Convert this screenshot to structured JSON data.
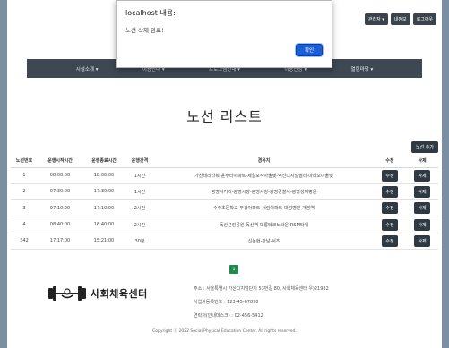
{
  "top_buttons": [
    "관리자 ▾",
    "내정보",
    "로그아웃"
  ],
  "nav": [
    "시설소개 ▾",
    "이용안내 ▾",
    "프로그램안내 ▾",
    "이용신청 ▾",
    "열린마당 ▾"
  ],
  "alert": {
    "title": "localhost 내용:",
    "message": "노선 삭제 완료!",
    "ok": "확인"
  },
  "heading": "노선 리스트",
  "add_button": "노선 추가",
  "table": {
    "headers": [
      "노선번호",
      "운행시작시간",
      "운행종료시간",
      "운행간격",
      "경유지",
      "수정",
      "삭제"
    ],
    "rows": [
      [
        "1",
        "08:00:00",
        "18:00:00",
        "1시간",
        "가산테라타워-윤부터아파트-제일포작아울렛-엑신디지털밸리-마리오아울렛"
      ],
      [
        "2",
        "07:30:00",
        "17:30:00",
        "1시간",
        "광명사거리-광명시장-광명시청-광명경찰서-광명성애병원"
      ],
      [
        "3",
        "07:10:00",
        "17:10:00",
        "2시간",
        "수주초등학교-부강아파트-서림아파트-대성병원-개봉역"
      ],
      [
        "4",
        "08:40:00",
        "16:40:00",
        "2시간",
        "독산근린공원-독산역-대륭테크노타운-RSM타워"
      ],
      [
        "342",
        "17:17:00",
        "15:21:00",
        "30분",
        "신논현-강남-서초"
      ]
    ],
    "edit_label": "수정",
    "delete_label": "삭제"
  },
  "pagination": [
    "1"
  ],
  "footer": {
    "logo_text": "사회체육센터",
    "address": "주소 : 서울특별시 가산디지털단지 53번길 80, 사회체육센터   우)21982",
    "phone": "사업자등록번호 : 123-45-67898",
    "contact": "연락처(안내데스크) : 02-456-5412",
    "copyright": "Copyright ⓒ 2022 Social Physical Education Center. All rights reserved."
  }
}
